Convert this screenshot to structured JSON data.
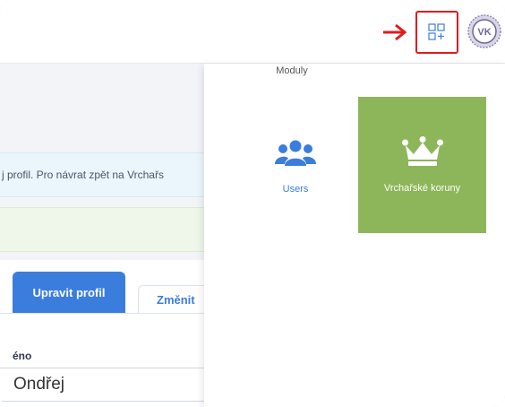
{
  "header": {
    "modules_icon": "grid-plus-icon",
    "avatar_initials": "VK",
    "arrow_color": "#e21b1b"
  },
  "page": {
    "info_text": "j profil. Pro návrat zpět na Vrchařs",
    "tabs": [
      {
        "label": "Upravit profil",
        "active": true
      },
      {
        "label": "Změnit",
        "active": false
      }
    ],
    "field": {
      "label": "éno",
      "value": "Ondřej"
    },
    "accent": "#3b7ddd"
  },
  "dropdown": {
    "title": "Moduly",
    "modules": [
      {
        "label": "Users",
        "icon": "users-icon"
      },
      {
        "label": "Vrchařské koruny",
        "icon": "crown-icon",
        "bg": "#8db65a"
      }
    ]
  }
}
